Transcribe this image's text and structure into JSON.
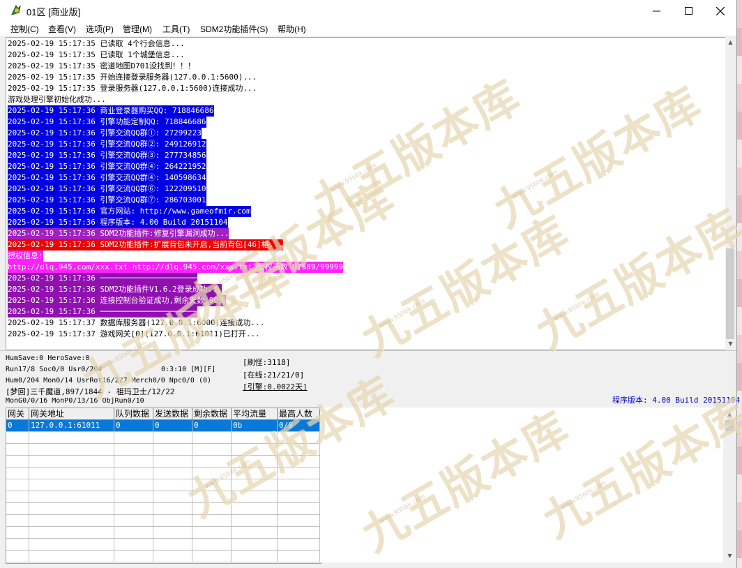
{
  "window": {
    "title": "01区 [商业版]"
  },
  "menu": [
    "控制(C)",
    "查看(V)",
    "选项(P)",
    "管理(M)",
    "工具(T)",
    "SDM2功能插件(S)",
    "帮助(H)"
  ],
  "log": [
    {
      "text": "2025-02-19 15:17:35 已读取 4个行会信息...",
      "fg": "#000000",
      "bg": ""
    },
    {
      "text": "2025-02-19 15:17:35 已读取 1个城堡信息...",
      "fg": "#000000",
      "bg": ""
    },
    {
      "text": "2025-02-19 15:17:35 密道地图D701没找到！！！",
      "fg": "#000000",
      "bg": ""
    },
    {
      "text": "2025-02-19 15:17:35 开始连接登录服务器(127.0.0.1:5600)...",
      "fg": "#000000",
      "bg": ""
    },
    {
      "text": "2025-02-19 15:17:35 登录服务器(127.0.0.1:5600)连接成功...",
      "fg": "#000000",
      "bg": ""
    },
    {
      "text": "游戏处理引擎初始化成功...",
      "fg": "#000000",
      "bg": ""
    },
    {
      "text": "2025-02-19 15:17:36 商业登录器购买QQ: 718846686",
      "fg": "#ffffff",
      "bg": "#0000e0"
    },
    {
      "text": "2025-02-19 15:17:36 引擎功能定制QQ: 718846686",
      "fg": "#ffffff",
      "bg": "#0000e0"
    },
    {
      "text": "2025-02-19 15:17:36 引擎交流QQ群①: 27299223",
      "fg": "#ffffff",
      "bg": "#0000e0"
    },
    {
      "text": "2025-02-19 15:17:36 引擎交流QQ群②: 249126912",
      "fg": "#ffffff",
      "bg": "#0000e0"
    },
    {
      "text": "2025-02-19 15:17:36 引擎交流QQ群③: 277734856",
      "fg": "#ffffff",
      "bg": "#0000e0"
    },
    {
      "text": "2025-02-19 15:17:36 引擎交流QQ群④: 264221952",
      "fg": "#ffffff",
      "bg": "#0000e0"
    },
    {
      "text": "2025-02-19 15:17:36 引擎交流QQ群④: 140598634",
      "fg": "#ffffff",
      "bg": "#0000e0"
    },
    {
      "text": "2025-02-19 15:17:36 引擎交流QQ群⑥: 122209510",
      "fg": "#ffffff",
      "bg": "#0000e0"
    },
    {
      "text": "2025-02-19 15:17:36 引擎交流QQ群⑦: 286703001",
      "fg": "#ffffff",
      "bg": "#0000e0"
    },
    {
      "text": "2025-02-19 15:17:36 官方网站: http://www.gameofmir.com",
      "fg": "#ffffff",
      "bg": "#0000e0"
    },
    {
      "text": "2025-02-19 15:17:36 程序版本: 4.00 Build 20151104",
      "fg": "#ffffff",
      "bg": "#0000e0"
    },
    {
      "text": "2025-02-19 15:17:36 SDM2功能插件:修复引擎漏洞成功...",
      "fg": "#ffffff",
      "bg": "#a020c0"
    },
    {
      "text": "2025-02-19 15:17:36 SDM2功能插件:扩展背包未开启,当前背包[46]格...",
      "fg": "#ffffff",
      "bg": "#f00000"
    },
    {
      "text": "授权信息:",
      "fg": "#ffffff",
      "bg": "#ff20ff"
    },
    {
      "text": "http://dlq.945.com/xxx.txt http://dlq.945.com/xxx.txt 授权天数 97589/99999",
      "fg": "#ffffff",
      "bg": "#ff20ff"
    },
    {
      "text": "2025-02-19 15:17:36 ─────────────────────",
      "fg": "#ffffff",
      "bg": "#9010b0"
    },
    {
      "text": "2025-02-19 15:17:36 SDM2功能插件V1.6.2登录成功...",
      "fg": "#ffffff",
      "bg": "#9010b0"
    },
    {
      "text": "2025-02-19 15:17:36 连接控制台验证成功,剩余天数:90天",
      "fg": "#ffffff",
      "bg": "#9010b0"
    },
    {
      "text": "2025-02-19 15:17:36 ─────────────────────",
      "fg": "#ffffff",
      "bg": "#9010b0"
    },
    {
      "text": "2025-02-19 15:17:37 数据库服务器(127.0.0.1:6000)连接成功...",
      "fg": "#000000",
      "bg": ""
    },
    {
      "text": "2025-02-19 15:17:37 游戏网关[0](127.0.0.1:61011)已打开...",
      "fg": "#000000",
      "bg": ""
    }
  ],
  "status": {
    "line1": "HumSave:0 HeroSave:0",
    "line2": "Run17/8 Soc0/0 Usr0/204",
    "time": "0:3:10 [M][F]",
    "line3": "Hum0/204 Mon0/14 UsrRot16/227 Merch0/0 Npc0/0 (0)",
    "line4": "[梦回]三千魔道,897/1844 - 祖玛卫士/12/22",
    "line5": "MonG0/0/16 MonP0/13/16 ObjRun0/10",
    "refresh": "[刷怪:3118]",
    "online": "[在线:21/21/0]",
    "engine": "[引擎:0.0022天]",
    "version": "程序版本: 4.00 Build 20151104",
    "version_color": "#0000c0"
  },
  "gateway_table": {
    "headers": [
      "网关",
      "网关地址",
      "队列数据",
      "发送数据",
      "剩余数据",
      "平均流量",
      "最高人数"
    ],
    "rows": [
      [
        "0",
        "127.0.0.1:61011",
        "0",
        "0",
        "0",
        "0b",
        "0/0"
      ]
    ]
  },
  "watermark": {
    "text": "九五版本库",
    "url": "www.95bbk.com"
  }
}
